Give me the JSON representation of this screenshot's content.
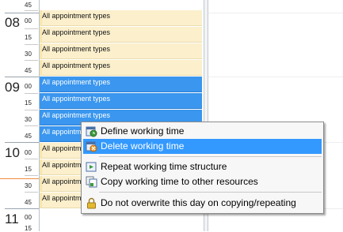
{
  "time_column": {
    "hours": [
      {
        "hour": "08",
        "minutes": [
          "00",
          "15",
          "30",
          "45"
        ]
      },
      {
        "hour": "09",
        "minutes": [
          "00",
          "15",
          "30",
          "45"
        ]
      },
      {
        "hour": "10",
        "minutes": [
          "00",
          "15",
          "30",
          "45"
        ]
      },
      {
        "hour": "11",
        "minutes": [
          "00",
          "15"
        ]
      }
    ],
    "top_minute": "45"
  },
  "appointments": {
    "label": "All appointment types"
  },
  "context_menu": {
    "items": [
      {
        "label": "Define working time",
        "icon": "define-working-time-icon"
      },
      {
        "label": "Delete working time",
        "icon": "delete-working-time-icon"
      },
      {
        "label": "Repeat working time structure",
        "icon": "repeat-icon"
      },
      {
        "label": "Copy working time to other resources",
        "icon": "copy-icon"
      },
      {
        "label": "Do not overwrite this day on copying/repeating",
        "icon": "lock-icon"
      }
    ]
  },
  "colors": {
    "slot_available": "#fbefcc",
    "slot_selected": "#3a96ee",
    "menu_highlight": "#3399ff",
    "now_line": "#f08a3c"
  }
}
